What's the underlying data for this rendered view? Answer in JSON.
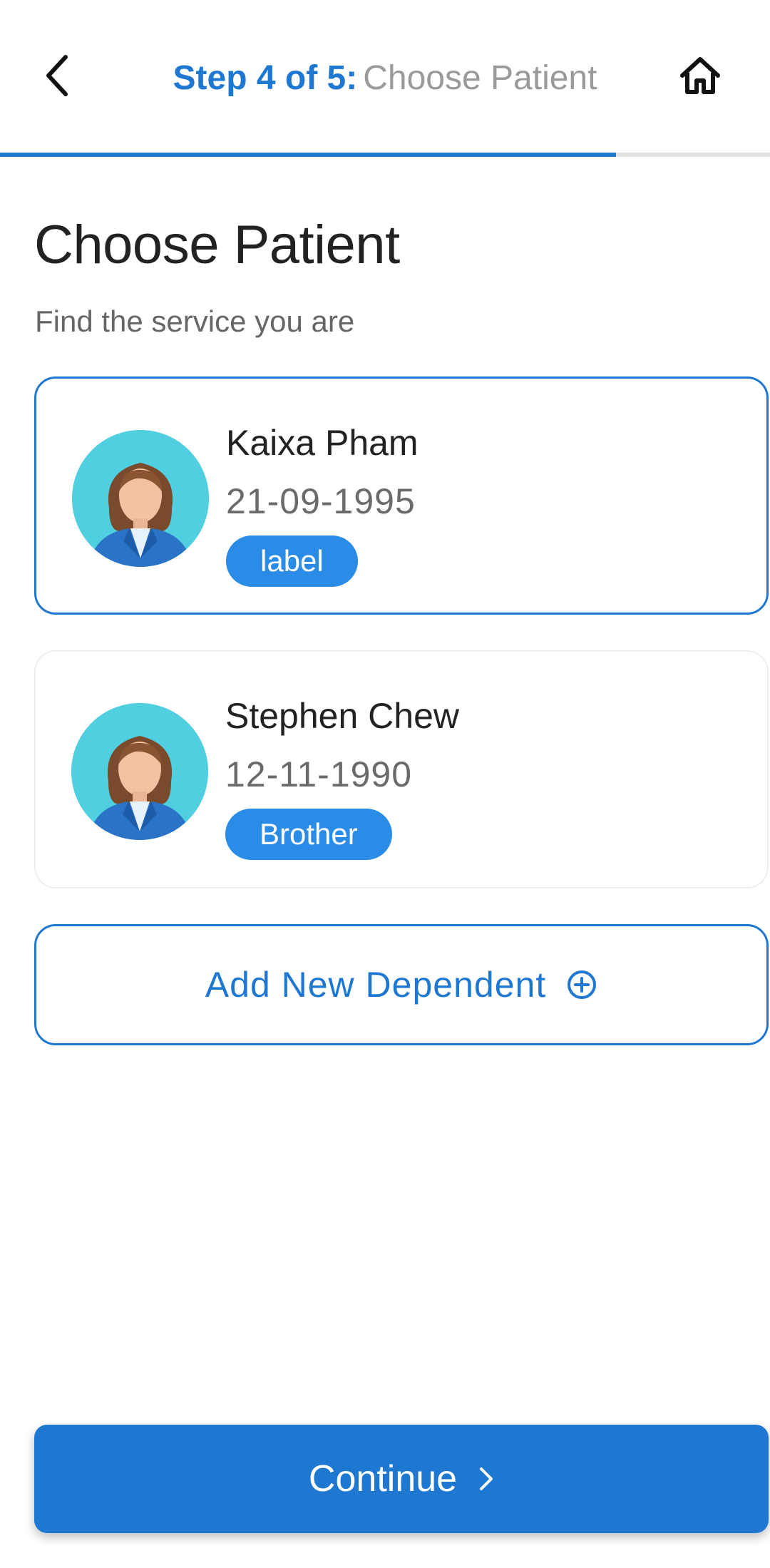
{
  "header": {
    "step_prefix": "Step 4 of 5:",
    "step_name": "Choose Patient",
    "back_icon": "chevron-left-icon",
    "home_icon": "home-icon",
    "progress_value": 0.8
  },
  "page": {
    "title": "Choose Patient",
    "subtitle": "Find the service you are"
  },
  "patients": [
    {
      "name": "Kaixa Pham",
      "dob": "21-09-1995",
      "badge": "label",
      "selected": true
    },
    {
      "name": "Stephen Chew",
      "dob": "12-11-1990",
      "badge": "Brother",
      "selected": false
    }
  ],
  "add_dependent": {
    "label": "Add New Dependent",
    "icon": "plus-circle-icon"
  },
  "continue_button": {
    "label": "Continue",
    "icon": "chevron-right-icon"
  },
  "colors": {
    "accent": "#1e78d2",
    "badge": "#2a8ce6",
    "avatar_bg": "#4fcfe0",
    "progress_track": "#e3e3e3"
  }
}
